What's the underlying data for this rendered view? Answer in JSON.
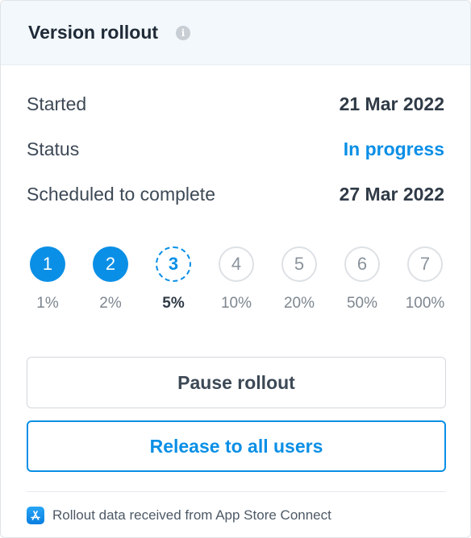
{
  "header": {
    "title": "Version rollout",
    "info_icon": "info-icon"
  },
  "details": [
    {
      "label": "Started",
      "value": "21 Mar 2022"
    },
    {
      "label": "Status",
      "value": "In progress"
    },
    {
      "label": "Scheduled to complete",
      "value": "27 Mar 2022"
    }
  ],
  "colors": {
    "accent": "#0a8fe6",
    "text": "#2f3a46",
    "muted": "#7d8690"
  },
  "phases": [
    {
      "number": "1",
      "percent": "1%",
      "state": "done"
    },
    {
      "number": "2",
      "percent": "2%",
      "state": "done"
    },
    {
      "number": "3",
      "percent": "5%",
      "state": "current"
    },
    {
      "number": "4",
      "percent": "10%",
      "state": "future"
    },
    {
      "number": "5",
      "percent": "20%",
      "state": "future"
    },
    {
      "number": "6",
      "percent": "50%",
      "state": "future"
    },
    {
      "number": "7",
      "percent": "100%",
      "state": "future"
    }
  ],
  "actions": {
    "pause_label": "Pause rollout",
    "release_label": "Release to all users"
  },
  "footer": {
    "icon": "app-store-icon",
    "text": "Rollout data received from App Store Connect"
  }
}
